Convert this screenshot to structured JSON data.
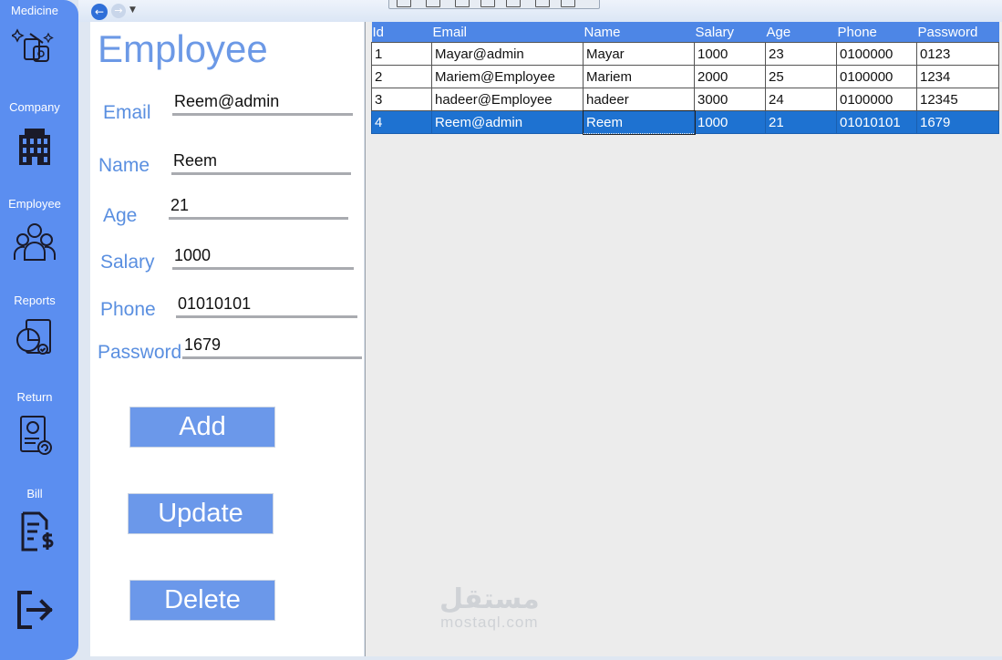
{
  "sidebar": {
    "items": [
      {
        "label": "Medicine",
        "icon": "medicine-icon"
      },
      {
        "label": "Company",
        "icon": "office-building-icon"
      },
      {
        "label": "Employee",
        "icon": "people-group-icon"
      },
      {
        "label": "Reports",
        "icon": "pie-chart-report-icon"
      },
      {
        "label": "Return",
        "icon": "return-document-icon"
      },
      {
        "label": "Bill",
        "icon": "bill-dollar-icon"
      }
    ],
    "logout_icon": "logout-icon"
  },
  "form": {
    "title": "Employee",
    "email_label": "Email",
    "email_value": "Reem@admin",
    "name_label": "Name",
    "name_value": "Reem",
    "age_label": "Age",
    "age_value": "21",
    "salary_label": "Salary",
    "salary_value": "1000",
    "phone_label": "Phone",
    "phone_value": "01010101",
    "password_label": "Password",
    "password_value": "1679",
    "add_label": "Add",
    "update_label": "Update",
    "delete_label": "Delete"
  },
  "grid": {
    "columns": [
      "Id",
      "Email",
      "Name",
      "Salary",
      "Age",
      "Phone",
      "Password"
    ],
    "rows": [
      [
        "1",
        "Mayar@admin",
        "Mayar",
        "1000",
        "23",
        "0100000",
        "0123"
      ],
      [
        "2",
        "Mariem@Employee",
        "Mariem",
        "2000",
        "25",
        "0100000",
        "1234"
      ],
      [
        "3",
        "hadeer@Employee",
        "hadeer",
        "3000",
        "24",
        "0100000",
        "12345"
      ],
      [
        "4",
        "Reem@admin",
        "Reem",
        "1000",
        "21",
        "01010101",
        "1679"
      ]
    ],
    "selected_row": 3
  },
  "watermark": {
    "arabic": "مستقل",
    "latin": "mostaql.com"
  },
  "colors": {
    "sidebar": "#5b8ef0",
    "accent": "#6b98ea",
    "selection": "#1e72d1"
  }
}
